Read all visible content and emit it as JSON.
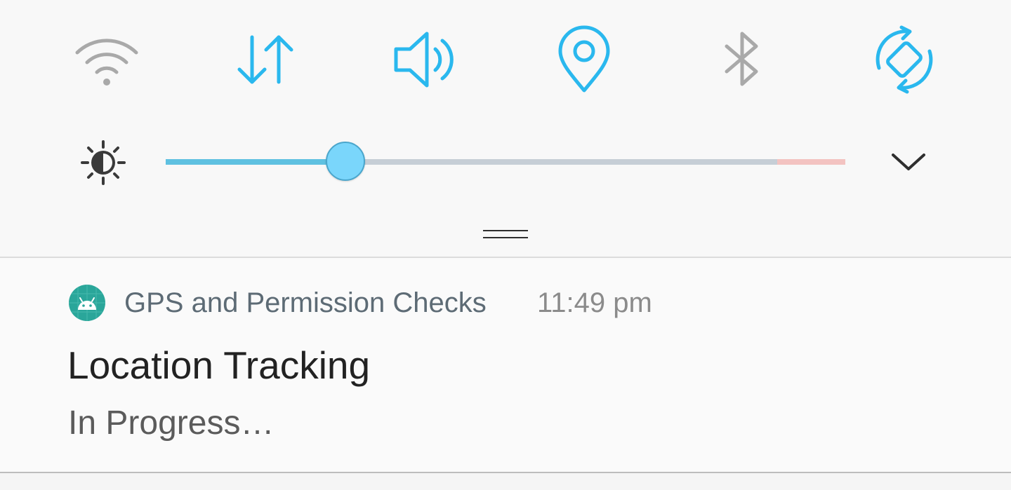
{
  "quick_settings": {
    "tiles": [
      {
        "name": "Wi-Fi",
        "icon": "wifi-icon",
        "active": false
      },
      {
        "name": "Mobile data",
        "icon": "data-transfer-icon",
        "active": true
      },
      {
        "name": "Sound",
        "icon": "volume-icon",
        "active": true
      },
      {
        "name": "Location",
        "icon": "location-pin-icon",
        "active": true
      },
      {
        "name": "Bluetooth",
        "icon": "bluetooth-icon",
        "active": false
      },
      {
        "name": "Auto rotate",
        "icon": "auto-rotate-icon",
        "active": true
      }
    ],
    "colors": {
      "active": "#2ab8ee",
      "inactive": "#a9a9a9"
    }
  },
  "brightness": {
    "icon": "brightness-icon",
    "level_fraction": 0.264,
    "danger_zone_fraction": 0.1,
    "colors": {
      "fill": "#5fc1e1",
      "track": "#c6ced6",
      "danger": "#f3c3c1",
      "thumb": "#7ad6fb"
    },
    "expand_icon": "chevron-down-icon"
  },
  "notification": {
    "app_icon": "android-icon",
    "app_name": "GPS and Permission Checks",
    "time": "11:49 pm",
    "title": "Location Tracking",
    "text": "In Progress…"
  }
}
